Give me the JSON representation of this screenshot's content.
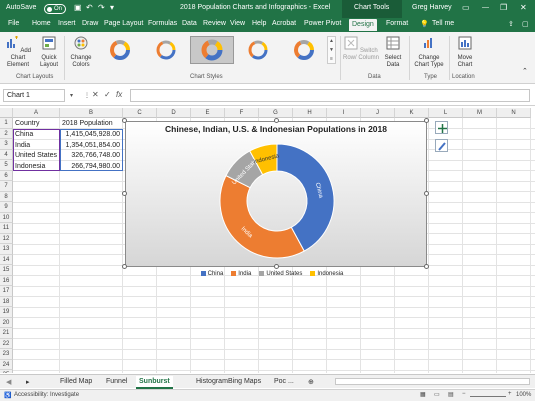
{
  "window": {
    "autosave_label": "AutoSave",
    "autosave_state": "On",
    "title": "2018 Population Charts and Infographics - Excel",
    "context_tab": "Chart Tools",
    "user": "Greg Harvey"
  },
  "ribbon_tabs": [
    "File",
    "Home",
    "Insert",
    "Draw",
    "Page Layout",
    "Formulas",
    "Data",
    "Review",
    "View",
    "Help",
    "Acrobat",
    "Power Pivot",
    "Design",
    "Format",
    "Tell me"
  ],
  "active_tab": "Design",
  "ribbon": {
    "add_chart_element": "Add Chart Element",
    "quick_layout": "Quick Layout",
    "change_colors": "Change Colors",
    "switch_row_column": "Switch Row/ Column",
    "select_data": "Select Data",
    "change_chart_type": "Change Chart Type",
    "move_chart": "Move Chart",
    "groups": {
      "chart_layouts": "Chart Layouts",
      "chart_styles": "Chart Styles",
      "data": "Data",
      "type": "Type",
      "location": "Location"
    }
  },
  "formula_bar": {
    "name_box": "Chart 1",
    "cancel": "✕",
    "enter": "✓",
    "fx": "fx",
    "formula": ""
  },
  "columns": [
    "A",
    "B",
    "C",
    "D",
    "E",
    "F",
    "G",
    "H",
    "I",
    "J",
    "K",
    "L",
    "M",
    "N"
  ],
  "rows": [
    "1",
    "2",
    "3",
    "4",
    "5",
    "6",
    "7",
    "8",
    "9",
    "10",
    "11",
    "12",
    "13",
    "14",
    "15",
    "16",
    "17",
    "18",
    "19",
    "20",
    "21",
    "22",
    "23",
    "24",
    "25"
  ],
  "cells": {
    "header_country": "Country",
    "header_population": "2018 Population",
    "data": [
      {
        "country": "China",
        "population": "1,415,045,928.00"
      },
      {
        "country": "India",
        "population": "1,354,051,854.00"
      },
      {
        "country": "United States",
        "population": "326,766,748.00"
      },
      {
        "country": "Indonesia",
        "population": "266,794,980.00"
      }
    ]
  },
  "chart_data": {
    "type": "pie",
    "donut": true,
    "title": "Chinese, Indian, U.S. & Indonesian Populations in 2018",
    "categories": [
      "China",
      "India",
      "United States",
      "Indonesia"
    ],
    "values": [
      1415045928,
      1354051854,
      326766748,
      266794980
    ],
    "colors": [
      "#4472c4",
      "#ed7d31",
      "#a5a5a5",
      "#ffc000"
    ],
    "legend_position": "bottom",
    "slice_labels": [
      "China",
      "India",
      "United States",
      "Indonesia"
    ]
  },
  "sheet_tabs": [
    "Filled Map",
    "Funnel",
    "Sunburst",
    "Histogram",
    "Bing Maps",
    "Poc ..."
  ],
  "active_sheet": "Sunburst",
  "status": {
    "accessibility": "Accessibility: Investigate",
    "zoom": "100%"
  },
  "accent_color": "#217346"
}
